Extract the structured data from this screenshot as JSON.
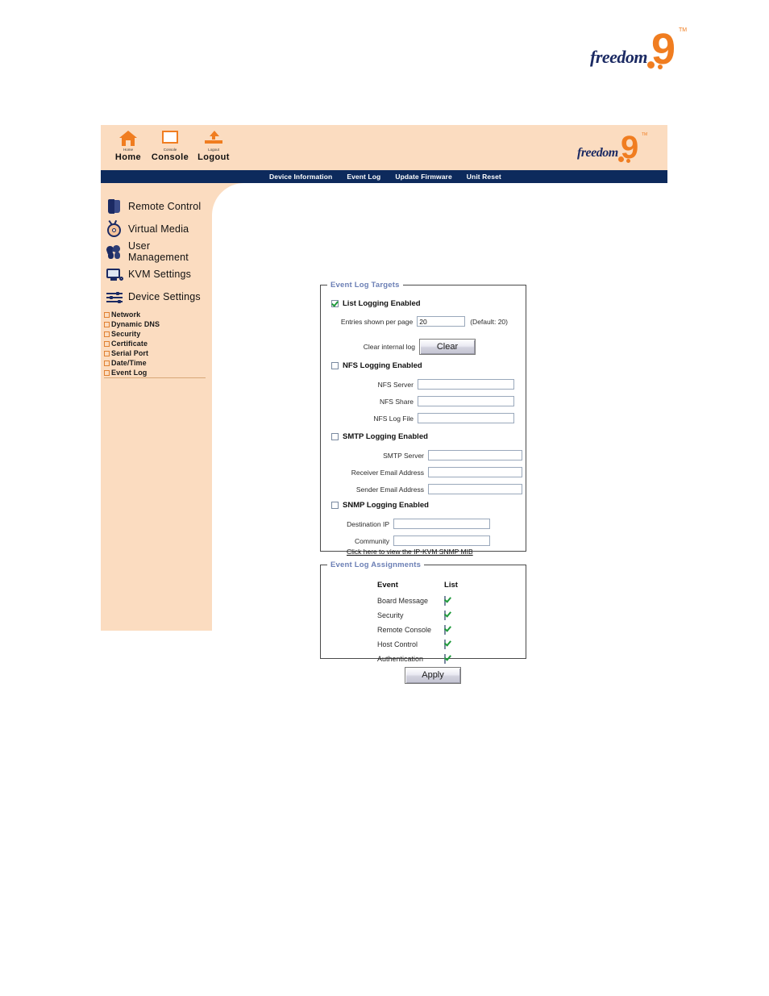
{
  "brand": {
    "word": "freedom",
    "numeral": "9",
    "tm": "TM"
  },
  "toolbar": {
    "items": [
      {
        "label": "Home",
        "sublabel": "Home",
        "icon": "house-icon"
      },
      {
        "label": "Console",
        "sublabel": "Console",
        "icon": "monitor-icon"
      },
      {
        "label": "Logout",
        "sublabel": "Logout",
        "icon": "logout-arrow-icon"
      }
    ]
  },
  "topnav": {
    "items": [
      "Device Information",
      "Event Log",
      "Update Firmware",
      "Unit Reset"
    ]
  },
  "sidebar": {
    "sections": [
      {
        "label": "Remote Control",
        "icon": "remote-control-icon"
      },
      {
        "label": "Virtual Media",
        "icon": "disc-icon"
      },
      {
        "label": "User Management",
        "icon": "users-icon"
      },
      {
        "label": "KVM Settings",
        "icon": "monitor-settings-icon"
      },
      {
        "label": "Device Settings",
        "icon": "sliders-icon"
      }
    ],
    "sublinks": [
      {
        "label": "Network",
        "selected": false
      },
      {
        "label": "Dynamic DNS",
        "selected": false
      },
      {
        "label": "Security",
        "selected": false
      },
      {
        "label": "Certificate",
        "selected": false
      },
      {
        "label": "Serial Port",
        "selected": false
      },
      {
        "label": "Date/Time",
        "selected": false
      },
      {
        "label": "Event Log",
        "selected": true
      }
    ]
  },
  "targets": {
    "legend": "Event Log Targets",
    "list": {
      "checkbox_label": "List Logging Enabled",
      "checked": true,
      "entries_label": "Entries shown per page",
      "entries_value": "20",
      "entries_hint": "(Default: 20)",
      "clear_label": "Clear internal log",
      "clear_button": "Clear"
    },
    "nfs": {
      "checkbox_label": "NFS Logging Enabled",
      "checked": false,
      "fields": [
        {
          "label": "NFS Server",
          "value": ""
        },
        {
          "label": "NFS Share",
          "value": ""
        },
        {
          "label": "NFS Log File",
          "value": ""
        }
      ]
    },
    "smtp": {
      "checkbox_label": "SMTP Logging Enabled",
      "checked": false,
      "fields": [
        {
          "label": "SMTP Server",
          "value": ""
        },
        {
          "label": "Receiver Email Address",
          "value": ""
        },
        {
          "label": "Sender Email Address",
          "value": ""
        }
      ]
    },
    "snmp": {
      "checkbox_label": "SNMP Logging Enabled",
      "checked": false,
      "fields": [
        {
          "label": "Destination IP",
          "value": ""
        },
        {
          "label": "Community",
          "value": ""
        }
      ],
      "mib_link": "Click here to view the IP-KVM SNMP MIB"
    }
  },
  "assignments": {
    "legend": "Event Log Assignments",
    "columns": [
      "Event",
      "List"
    ],
    "rows": [
      {
        "event": "Board Message",
        "list": true
      },
      {
        "event": "Security",
        "list": true
      },
      {
        "event": "Remote Console",
        "list": true
      },
      {
        "event": "Host Control",
        "list": true
      },
      {
        "event": "Authentication",
        "list": true
      }
    ]
  },
  "actions": {
    "apply": "Apply"
  },
  "colors": {
    "brand_orange": "#f07d20",
    "brand_navy": "#1b2a63",
    "navbar": "#0d2a5c",
    "peach": "#fbdcc0",
    "legend_blue": "#6b7fb5",
    "check_green": "#1f9a3c"
  }
}
